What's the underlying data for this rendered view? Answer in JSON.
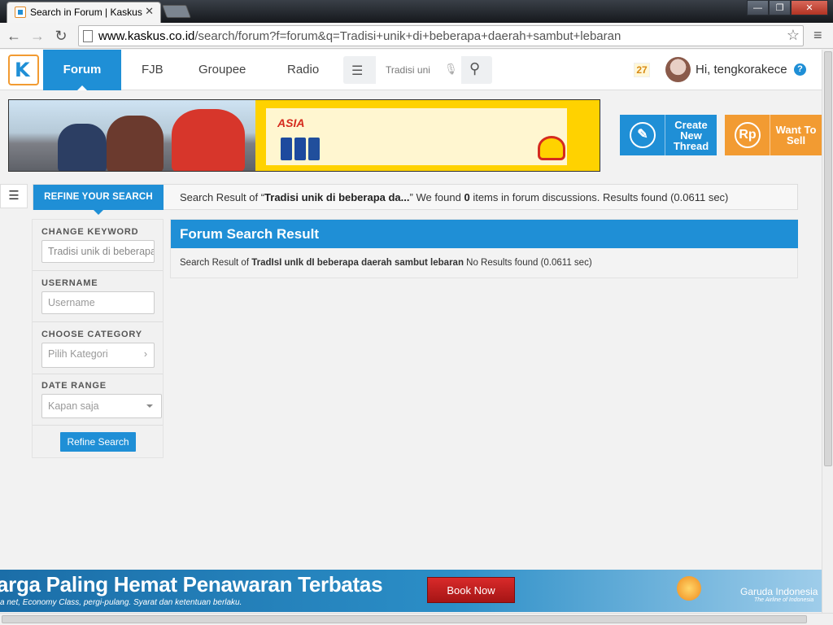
{
  "browser": {
    "tab_title": "Search in Forum | Kaskus -",
    "tab_close": "✕",
    "url_host": "www.kaskus.co.id",
    "url_path": "/search/forum?f=forum&q=Tradisi+unik+di+beberapa+daerah+sambut+lebaran",
    "back_icon": "←",
    "forward_icon": "→",
    "reload_icon": "↻",
    "star_icon": "☆",
    "menu_icon": "≡"
  },
  "header": {
    "logo_letter": "K",
    "nav": {
      "forum": "Forum",
      "fjb": "FJB",
      "groupee": "Groupee",
      "radio": "Radio"
    },
    "search_value": "Tradisi uni",
    "notification_count": "27",
    "greeting": "Hi, tengkorakece",
    "help": "?"
  },
  "cta": {
    "create_thread": "Create New Thread",
    "want_to_sell": "Want To Sell",
    "sell_icon_text": "Rp"
  },
  "banner": {
    "asia_text": "ASIA"
  },
  "refine": {
    "tab_label": "REFINE YOUR SEARCH",
    "result_prefix": "Search Result of “",
    "result_query": "Tradisi unik di beberapa da...",
    "result_mid": "” We found ",
    "result_count": "0",
    "result_suffix": " items in forum discussions. Results found (0.0611 sec)"
  },
  "filters": {
    "keyword_label": "CHANGE KEYWORD",
    "keyword_value": "Tradisi unik di beberapa",
    "username_label": "USERNAME",
    "username_placeholder": "Username",
    "category_label": "CHOOSE CATEGORY",
    "category_value": "Pilih Kategori",
    "date_label": "DATE RANGE",
    "date_value": "Kapan saja",
    "button": "Refine Search"
  },
  "result_panel": {
    "title": "Forum Search Result",
    "prefix": "Search Result of ",
    "query": "TradIsI unIk dI beberapa daerah sambut lebaran",
    "suffix": " No Results found (0.0611 sec)"
  },
  "bottom_ad": {
    "headline": "arga Paling Hemat Penawaran Terbatas",
    "subline": "a net, Economy Class, pergi-pulang. Syarat dan ketentuan berlaku.",
    "button": "Book Now",
    "brand": "Garuda Indonesia",
    "brand_sub": "The Airline of Indonesia"
  },
  "colors": {
    "primary_blue": "#1f8fd6",
    "accent_orange": "#f29b32"
  }
}
